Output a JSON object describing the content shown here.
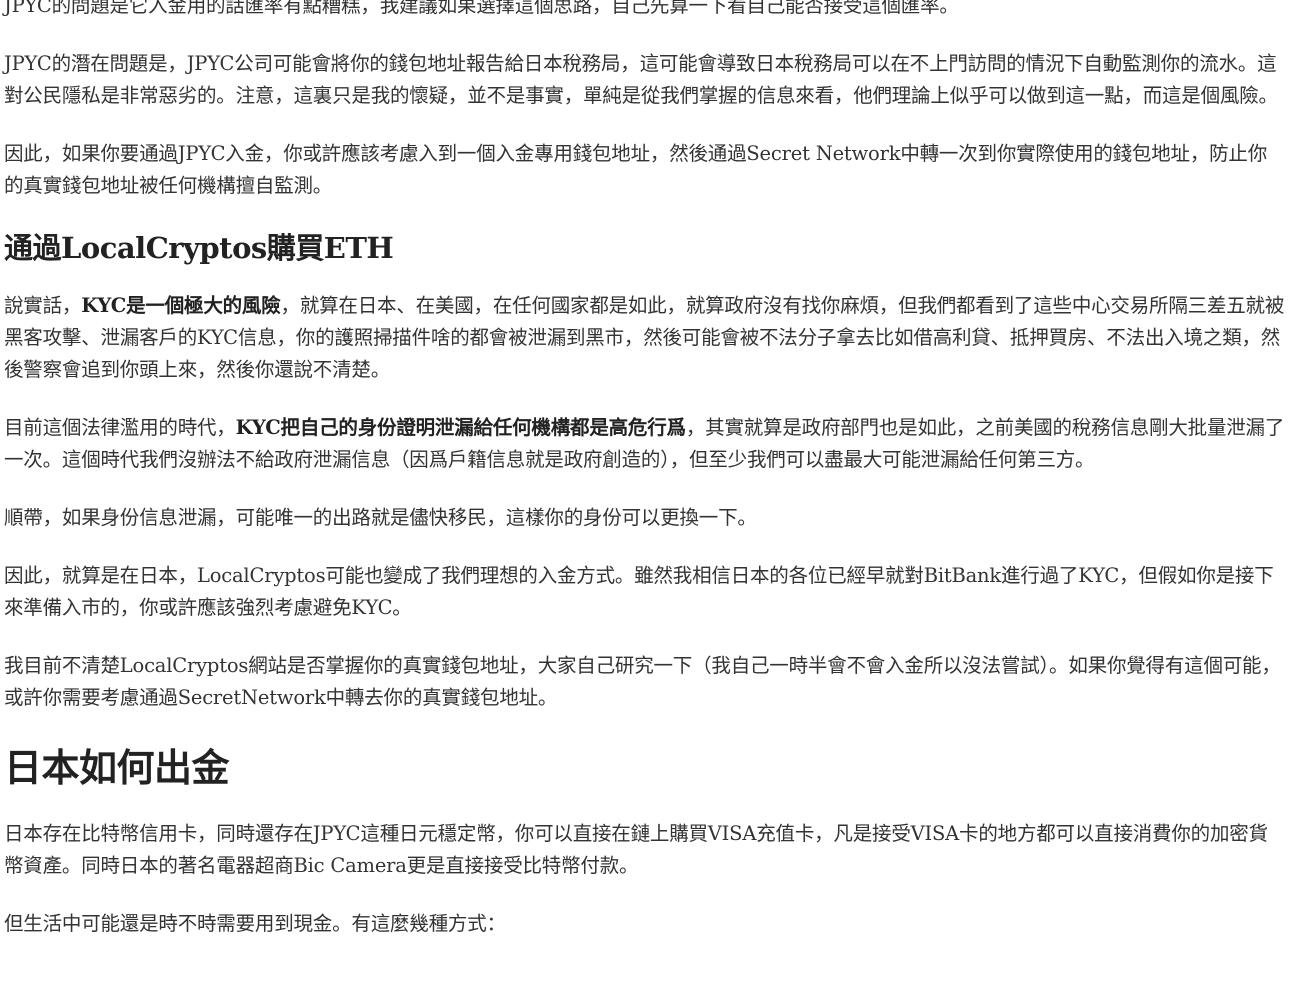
{
  "article": {
    "p1": "JPYC的問題是它入金用的話匯率有點糟糕，我建議如果選擇這個思路，自己先算一下看自己能否接受這個匯率。",
    "p2": "JPYC的潛在問題是，JPYC公司可能會將你的錢包地址報告給日本稅務局，這可能會導致日本稅務局可以在不上門訪問的情況下自動監測你的流水。這對公民隱私是非常惡劣的。注意，這裏只是我的懷疑，並不是事實，單純是從我們掌握的信息來看，他們理論上似乎可以做到這一點，而這是個風險。",
    "p3": "因此，如果你要通過JPYC入金，你或許應該考慮入到一個入金專用錢包地址，然後通過Secret Network中轉一次到你實際使用的錢包地址，防止你的真實錢包地址被任何機構擅自監測。",
    "h_localcryptos": "通過LocalCryptos購買ETH",
    "p4_pre": "說實話，",
    "p4_strong": "KYC是一個極大的風險",
    "p4_post": "，就算在日本、在美國，在任何國家都是如此，就算政府沒有找你麻煩，但我們都看到了這些中心交易所隔三差五就被黑客攻擊、泄漏客戶的KYC信息，你的護照掃描件啥的都會被泄漏到黑市，然後可能會被不法分子拿去比如借高利貸、抵押買房、不法出入境之類，然後警察會追到你頭上來，然後你還說不清楚。",
    "p5_pre": "目前這個法律濫用的時代，",
    "p5_strong": "KYC把自己的身份證明泄漏給任何機構都是高危行爲",
    "p5_post": "，其實就算是政府部門也是如此，之前美國的稅務信息剛大批量泄漏了一次。這個時代我們沒辦法不給政府泄漏信息（因爲戶籍信息就是政府創造的），但至少我們可以盡最大可能泄漏給任何第三方。",
    "p6": "順帶，如果身份信息泄漏，可能唯一的出路就是儘快移民，這樣你的身份可以更換一下。",
    "p7": "因此，就算是在日本，LocalCryptos可能也變成了我們理想的入金方式。雖然我相信日本的各位已經早就對BitBank進行過了KYC，但假如你是接下來準備入市的，你或許應該強烈考慮避免KYC。",
    "p8": "我目前不清楚LocalCryptos網站是否掌握你的真實錢包地址，大家自己研究一下（我自己一時半會不會入金所以沒法嘗試）。如果你覺得有這個可能，或許你需要考慮通過SecretNetwork中轉去你的真實錢包地址。",
    "h_withdraw": "日本如何出金",
    "p9": "日本存在比特幣信用卡，同時還存在JPYC這種日元穩定幣，你可以直接在鏈上購買VISA充值卡，凡是接受VISA卡的地方都可以直接消費你的加密貨幣資產。同時日本的著名電器超商Bic Camera更是直接接受比特幣付款。",
    "p10": "但生活中可能還是時不時需要用到現金。有這麼幾種方式："
  }
}
